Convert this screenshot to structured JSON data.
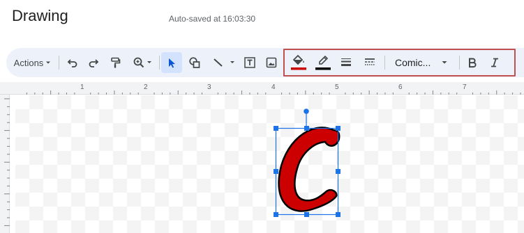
{
  "app": {
    "title": "Drawing",
    "autosave_text": "Auto-saved at 16:03:30"
  },
  "toolbar": {
    "actions_label": "Actions",
    "font_name": "Comic...",
    "fill_color": "#cc0000",
    "line_color": "#000000",
    "accent_color": "#1a73e8",
    "highlight_color": "#c0504d",
    "items": [
      {
        "name": "undo",
        "icon": "undo-icon"
      },
      {
        "name": "redo",
        "icon": "redo-icon"
      },
      {
        "name": "paint-format",
        "icon": "paint-roller-icon"
      },
      {
        "name": "zoom",
        "icon": "zoom-icon"
      },
      {
        "name": "select",
        "icon": "cursor-icon"
      },
      {
        "name": "shape",
        "icon": "shape-icon"
      },
      {
        "name": "line",
        "icon": "line-icon"
      },
      {
        "name": "text-box",
        "icon": "text-box-icon"
      },
      {
        "name": "image",
        "icon": "image-icon"
      },
      {
        "name": "fill-color",
        "icon": "paint-bucket-icon"
      },
      {
        "name": "border-color",
        "icon": "pencil-icon"
      },
      {
        "name": "border-weight",
        "icon": "border-weight-icon"
      },
      {
        "name": "border-dash",
        "icon": "border-dash-icon"
      },
      {
        "name": "bold",
        "icon": "bold-icon"
      },
      {
        "name": "italic",
        "icon": "italic-icon"
      }
    ]
  },
  "ruler": {
    "labels": [
      "1",
      "2",
      "3",
      "4",
      "5",
      "6",
      "7"
    ]
  },
  "canvas": {
    "selected_shape": {
      "text": "C",
      "fill": "#cc0000",
      "stroke": "#000000"
    }
  }
}
